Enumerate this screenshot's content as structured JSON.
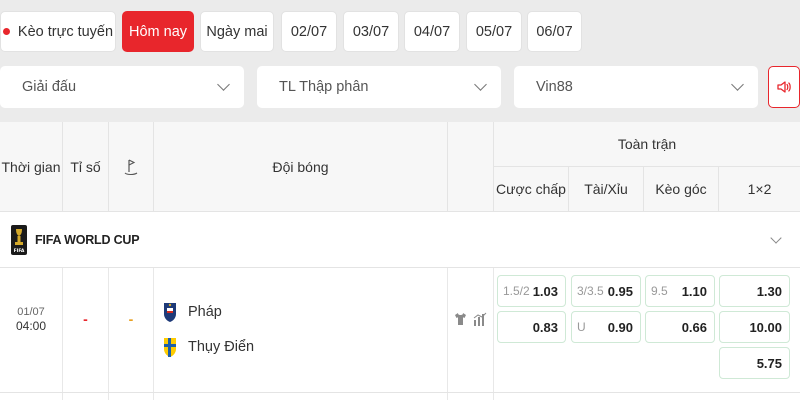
{
  "tabs": [
    {
      "label": "Kèo trực tuyến",
      "active": false,
      "live": true
    },
    {
      "label": "Hôm nay",
      "active": true
    },
    {
      "label": "Ngày mai",
      "active": false
    },
    {
      "label": "02/07",
      "active": false
    },
    {
      "label": "03/07",
      "active": false
    },
    {
      "label": "04/07",
      "active": false
    },
    {
      "label": "05/07",
      "active": false
    },
    {
      "label": "06/07",
      "active": false
    }
  ],
  "filters": {
    "league": "Giải đấu",
    "odds_format": "TL Thập phân",
    "bookmaker": "Vin88"
  },
  "table": {
    "headers": {
      "time": "Thời gian",
      "score": "Tỉ số",
      "teams": "Đội bóng",
      "full_match": "Toàn trận",
      "handicap": "Cược chấp",
      "over_under": "Tài/Xỉu",
      "corners": "Kèo góc",
      "one_x_two": "1×2"
    },
    "league": {
      "name": "FIFA WORLD CUP"
    },
    "match": {
      "date": "01/07",
      "time": "04:00",
      "score": "-",
      "half_score": "-",
      "home": "Pháp",
      "away": "Thụy Điển",
      "handicap": {
        "line": "1.5/2",
        "home": "1.03",
        "away": "0.83"
      },
      "over_under": {
        "line": "3/3.5",
        "over": "0.95",
        "under_label": "U",
        "under": "0.90"
      },
      "corners": {
        "line": "9.5",
        "over": "1.10",
        "under": "0.66"
      },
      "one_x_two": {
        "home": "1.30",
        "away": "10.00",
        "draw": "5.75"
      }
    }
  },
  "colors": {
    "accent": "#e8262c",
    "odds_border": "#cfe9d6",
    "background": "#ebebeb"
  }
}
